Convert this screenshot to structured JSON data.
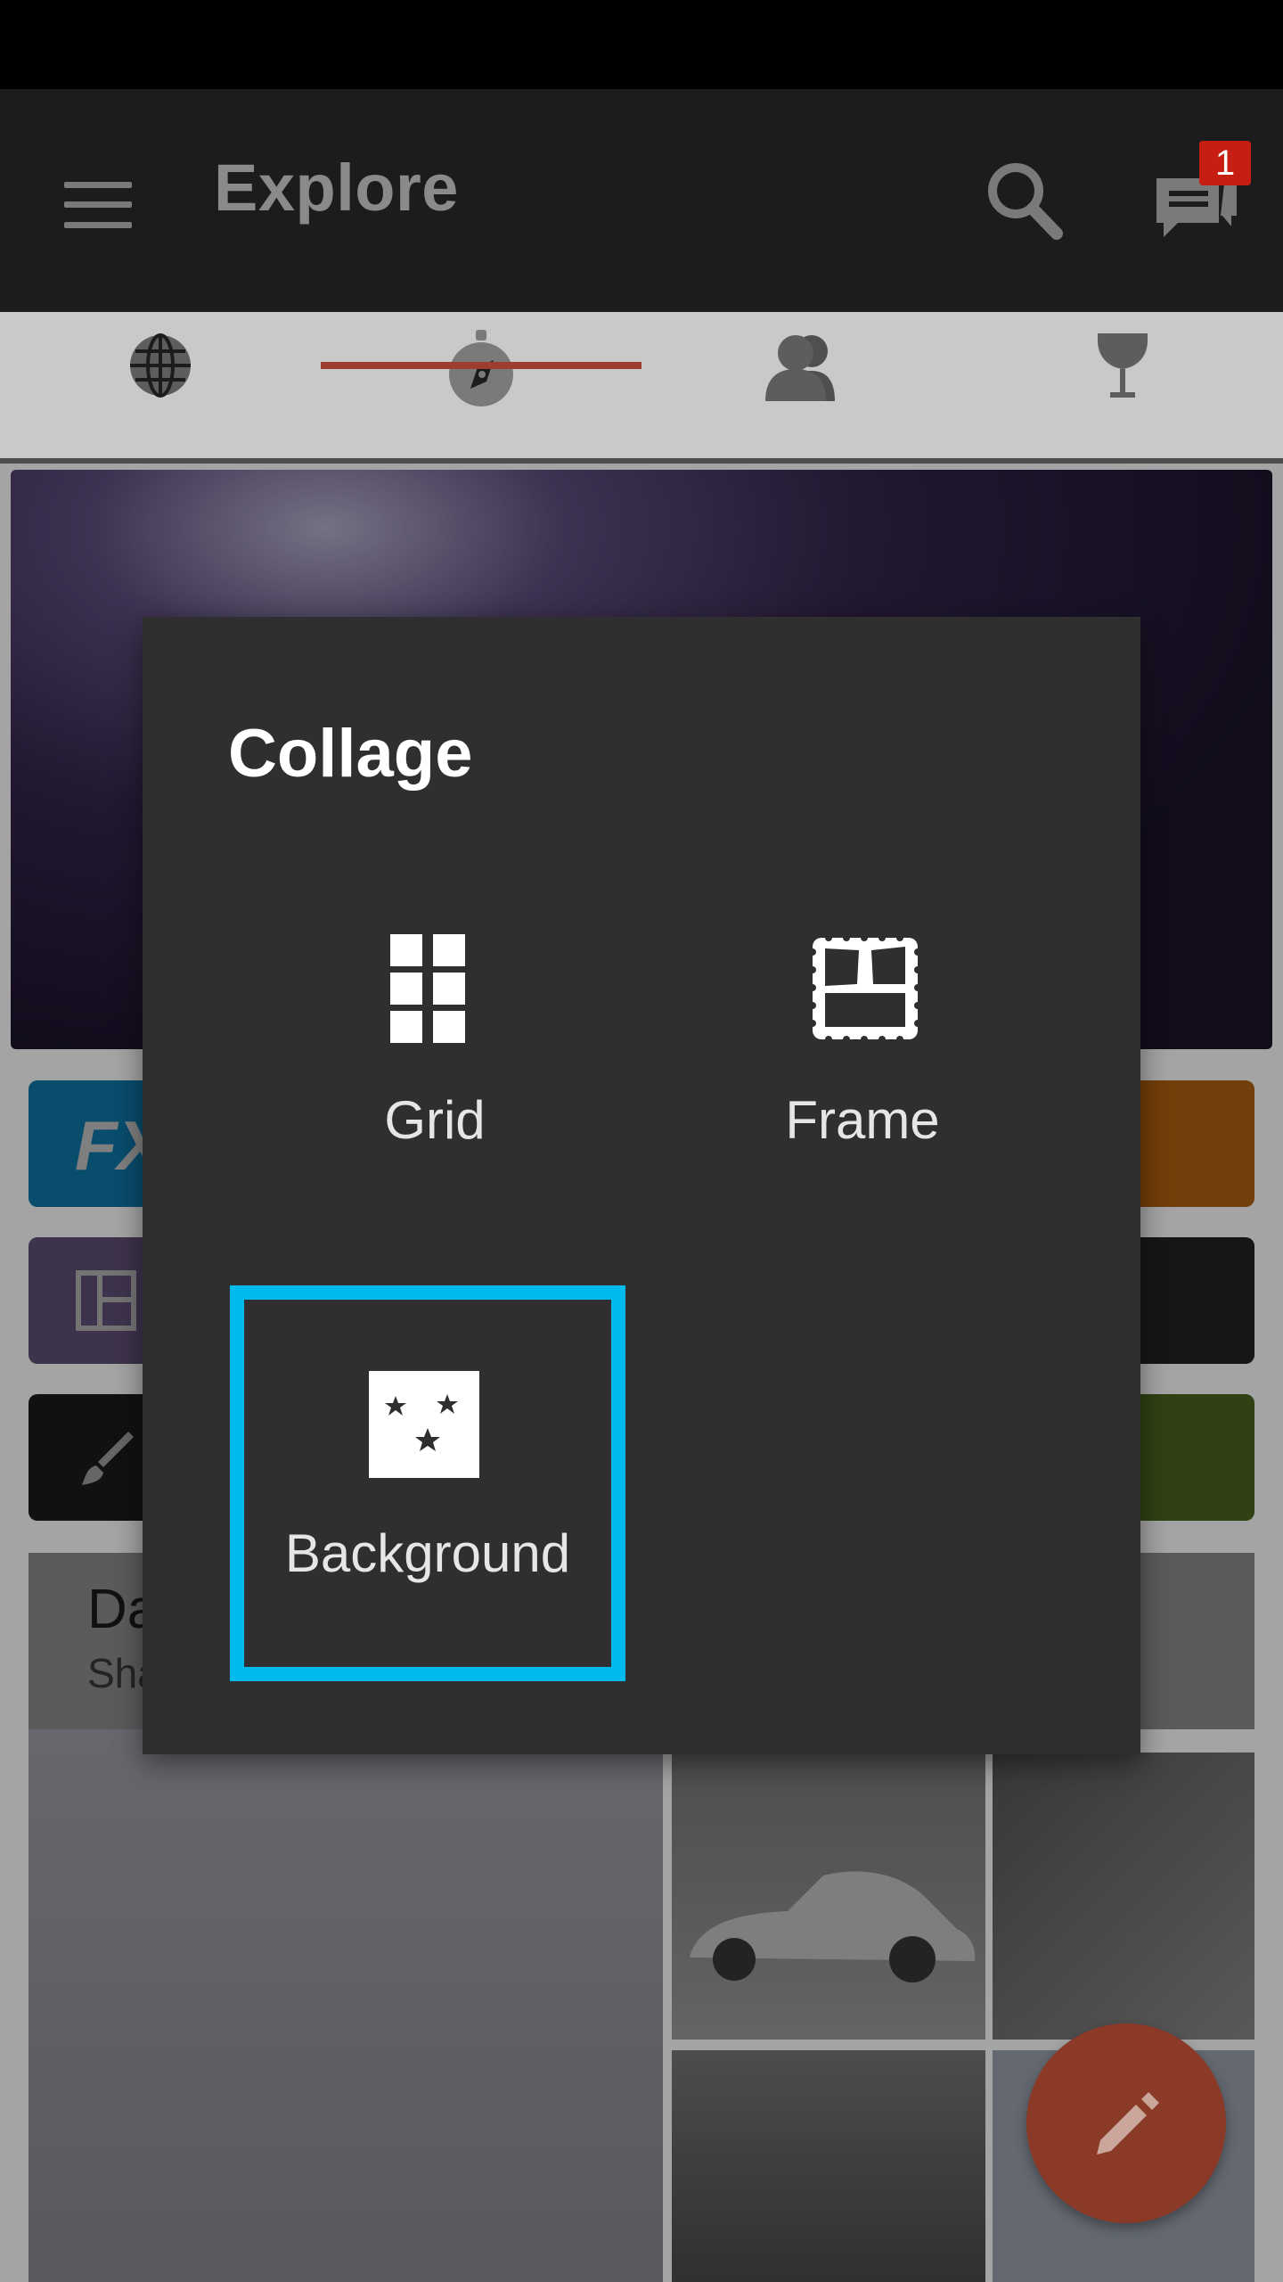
{
  "app_bar": {
    "title": "Explore",
    "menu_icon": "hamburger-menu-icon",
    "search_icon": "search-icon",
    "messages_icon": "chat-bubbles-icon",
    "messages_badge": "1"
  },
  "tabs": [
    {
      "name": "globe",
      "icon": "globe-icon",
      "selected": false
    },
    {
      "name": "explore",
      "icon": "compass-icon",
      "selected": true
    },
    {
      "name": "people",
      "icon": "people-icon",
      "selected": false
    },
    {
      "name": "contests",
      "icon": "trophy-icon",
      "selected": false
    }
  ],
  "background_content": {
    "tiles": [
      {
        "icon": "fx-icon",
        "glyph": "FX"
      },
      {
        "icon": "collage-icon",
        "glyph": ""
      },
      {
        "icon": "brush-icon",
        "glyph": ""
      }
    ],
    "card": {
      "title_partial": "Da",
      "subtitle_partial": "Sha"
    }
  },
  "dialog": {
    "title": "Collage",
    "options": [
      {
        "label": "Grid",
        "icon": "grid-icon",
        "selected": false
      },
      {
        "label": "Frame",
        "icon": "frame-icon",
        "selected": false
      },
      {
        "label": "Background",
        "icon": "stars-background-icon",
        "selected": true
      }
    ],
    "selection_color": "#00b9ef"
  },
  "fab": {
    "icon": "pencil-icon"
  },
  "colors": {
    "tab_indicator": "#9a3f30",
    "badge": "#c81d12",
    "fab": "#8a3a26"
  }
}
